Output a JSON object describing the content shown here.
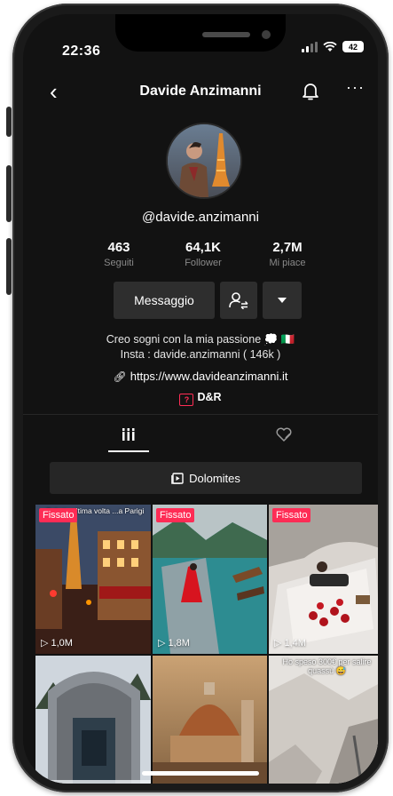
{
  "status_bar": {
    "time": "22:36",
    "battery": "42"
  },
  "header": {
    "title": "Davide Anzimanni"
  },
  "profile": {
    "username": "@davide.anzimanni",
    "stats": [
      {
        "value": "463",
        "label": "Seguiti"
      },
      {
        "value": "64,1K",
        "label": "Follower"
      },
      {
        "value": "2,7M",
        "label": "Mi piace"
      }
    ],
    "message_button": "Messaggio",
    "bio_line1": "Creo sogni con la mia passione 💭 🇮🇹",
    "bio_line2": "Insta : davide.anzimanni ( 146k )",
    "link": "https://www.davideanzimanni.it",
    "qa_label": "D&R"
  },
  "playlist": {
    "label": "Dolomites"
  },
  "videos": [
    {
      "pinned": "Fissato",
      "views": "1,0M",
      "caption": "Sabato ultima volta ...a Parigi"
    },
    {
      "pinned": "Fissato",
      "views": "1,8M",
      "caption": ""
    },
    {
      "pinned": "Fissato",
      "views": "1,4M",
      "caption": ""
    },
    {
      "pinned": "",
      "views": "",
      "caption": ""
    },
    {
      "pinned": "",
      "views": "",
      "caption": ""
    },
    {
      "pinned": "",
      "views": "",
      "caption": "Ho speso 300€ per salire quassù 😅"
    }
  ],
  "colors": {
    "accent": "#fe2c55",
    "background": "#121212",
    "button": "#2e2e2e"
  }
}
